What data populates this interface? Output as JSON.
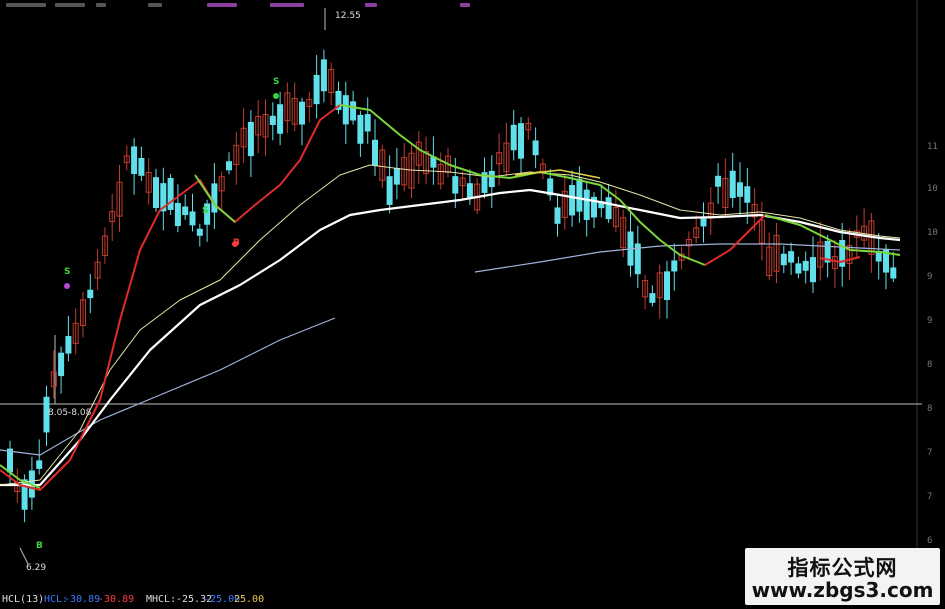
{
  "chart": {
    "high_label": "12.55",
    "low_label": "6.29",
    "ref_label": "8.05-8.08"
  },
  "signals": {
    "sell": "S",
    "buy": "B"
  },
  "indicator": {
    "name": "HCL(13)",
    "items": [
      {
        "label": "HCL:",
        "value": "-30.89",
        "color": "#3a7bff"
      },
      {
        "label": "",
        "value": "-30.89",
        "color": "#ff3b3b"
      },
      {
        "label": "MHCL:",
        "value": "-25.32",
        "color": "#dddddd"
      },
      {
        "label": "",
        "value": "-25.00",
        "color": "#3a7bff"
      },
      {
        "label": "",
        "value": "25.00",
        "color": "#e6c84a"
      }
    ]
  },
  "watermark": {
    "title": "指标公式网",
    "url": "www.zbgs3.com"
  },
  "colors": {
    "up": "#c23b2e",
    "down": "#5fe0ea",
    "ma_short_up": "#e02b2b",
    "ma_short_down": "#7ad63a",
    "ma_mid": "#e5e5a8",
    "ma_long": "#ffffff",
    "ma_xlong": "#9fb3d8"
  }
}
